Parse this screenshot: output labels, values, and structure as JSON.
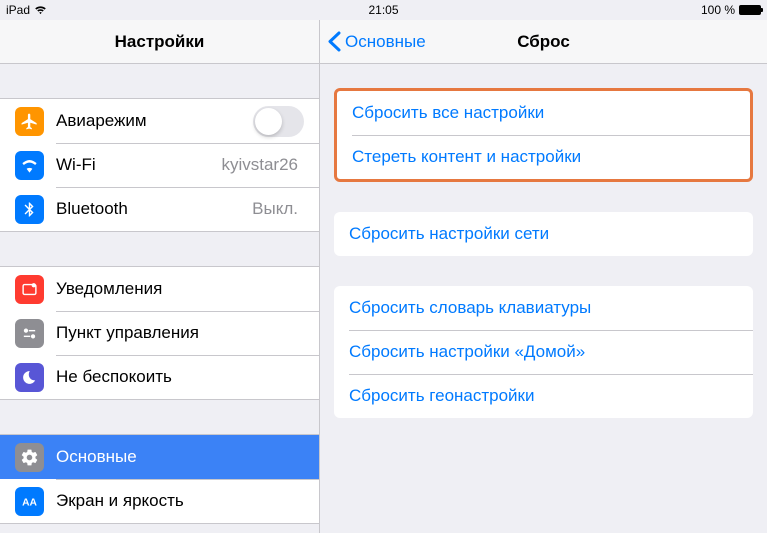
{
  "status": {
    "device": "iPad",
    "time": "21:05",
    "battery": "100 %"
  },
  "sidebar": {
    "title": "Настройки",
    "group1": [
      {
        "label": "Авиарежим",
        "value": "",
        "type": "toggle"
      },
      {
        "label": "Wi-Fi",
        "value": "kyivstar26",
        "type": "nav"
      },
      {
        "label": "Bluetooth",
        "value": "Выкл.",
        "type": "nav"
      }
    ],
    "group2": [
      {
        "label": "Уведомления"
      },
      {
        "label": "Пункт управления"
      },
      {
        "label": "Не беспокоить"
      }
    ],
    "group3": [
      {
        "label": "Основные",
        "selected": true
      },
      {
        "label": "Экран и яркость"
      }
    ]
  },
  "main": {
    "back": "Основные",
    "title": "Сброс",
    "highlight": [
      "Сбросить все настройки",
      "Стереть контент и настройки"
    ],
    "group2": [
      "Сбросить настройки сети"
    ],
    "group3": [
      "Сбросить словарь клавиатуры",
      "Сбросить настройки «Домой»",
      "Сбросить геонастройки"
    ]
  }
}
